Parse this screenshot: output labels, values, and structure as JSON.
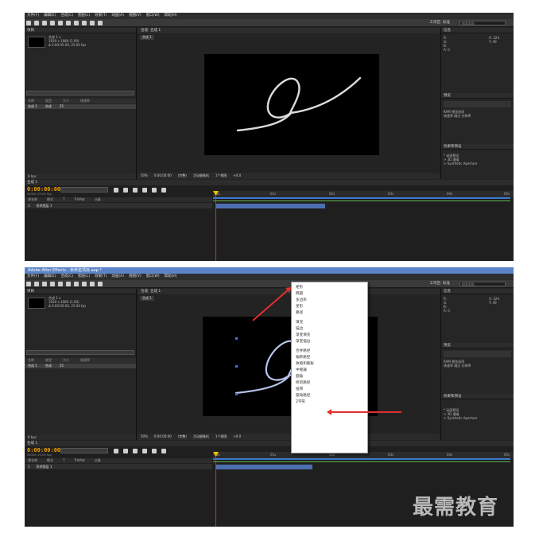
{
  "app": {
    "title": "Adobe After Effects - 未命名项目.aep *"
  },
  "menubar": [
    "文件(F)",
    "编辑(E)",
    "合成(C)",
    "图层(L)",
    "效果(T)",
    "动画(A)",
    "视图(V)",
    "窗口(W)",
    "帮助(H)"
  ],
  "toolbar": {
    "workspace": "工作区: 标准",
    "search": "搜索帮助"
  },
  "project": {
    "tab": "项目",
    "comp_name": "合成 1 ▾",
    "info1": "1920 x 1080 (1.00)",
    "info2": "Δ 0:00:05:00, 25.00 fps",
    "columns": [
      "名称",
      "类型",
      "大小",
      "帧速率"
    ],
    "row_name": "合成 1",
    "row_type": "合成",
    "row_fps": "25",
    "footer": "8 bpc"
  },
  "comp": {
    "tab": "合成: 合成 1",
    "crumb": "合成 1",
    "footer": [
      "50%",
      "0:00:00:00",
      "(完整)",
      "活动摄像机",
      "1个视图",
      "+0.0"
    ]
  },
  "right": {
    "info_tab": "信息",
    "info_lines": [
      "R:",
      "G:",
      "B:",
      "A: 0"
    ],
    "coords": [
      "X: 324",
      "Y: 49"
    ],
    "preview_tab": "预览",
    "preview_lines": [
      "RAM 预览选项",
      "帧速率  跳过  分辨率"
    ],
    "effects_tab": "效果和预设",
    "effects_lines": [
      "* 动画预设",
      "> 3D 通道",
      "> Synthetic Aperture"
    ]
  },
  "timeline": {
    "tab": "合成 1",
    "time": "0:00:00:00",
    "fps": "00000 (25.00 fps)",
    "columns": [
      "源名称",
      "模式",
      "T",
      "TrkMat",
      "父级"
    ],
    "layer_num": "1",
    "layer_name": "形状图层 1",
    "ruler": [
      "0s",
      "01s",
      "02s",
      "03s",
      "04s",
      "05s"
    ],
    "footer": "切换开关/模式"
  },
  "context_menu": {
    "items": [
      "矩形",
      "椭圆",
      "多边形",
      "星形",
      "路径",
      "填充",
      "描边",
      "渐变填充",
      "渐变描边",
      "合并路径",
      "偏移路径",
      "收缩和膨胀",
      "中继器",
      "圆角",
      "修剪路径",
      "扭转",
      "摆动路径",
      "Z字形"
    ]
  },
  "watermark": "最需教育"
}
